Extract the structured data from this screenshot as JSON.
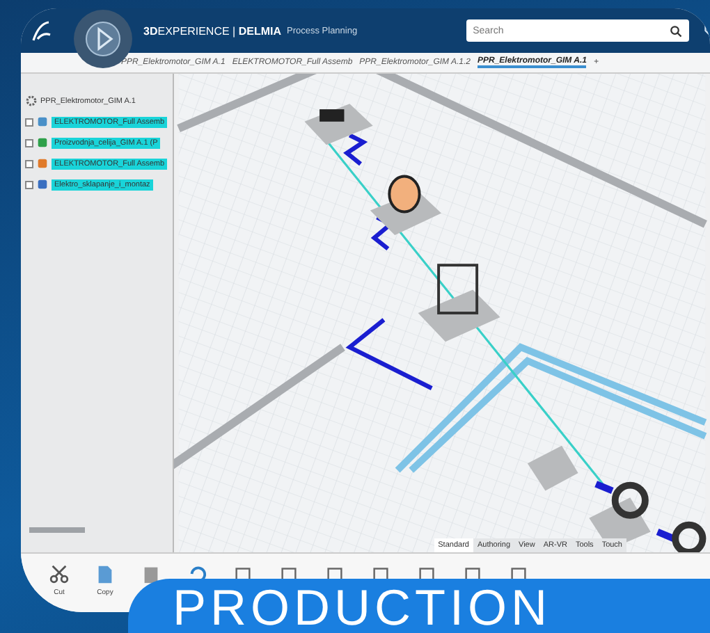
{
  "header": {
    "brand": "**3D**EXPERIENCE | **DELMIA**",
    "app_name": "Process Planning",
    "search": {
      "placeholder": "Search"
    }
  },
  "tabs": [
    {
      "label": "PPR_Elektromotor_GIM A.1",
      "selected": false
    },
    {
      "label": "ELEKTROMOTOR_Full Assemb",
      "selected": false
    },
    {
      "label": "PPR_Elektromotor_GIM A.1.2",
      "selected": false
    },
    {
      "label": "PPR_Elektromotor_GIM A.1",
      "selected": true
    },
    {
      "label": "+",
      "selected": false
    }
  ],
  "tree": {
    "root": "PPR_Elektromotor_GIM A.1",
    "children": [
      {
        "label": "ELEKTROMOTOR_Full Assemb",
        "kind": "product",
        "selected": true
      },
      {
        "label": "Proizvodnja_celija_GIM A.1 (P",
        "kind": "resource",
        "selected": true
      },
      {
        "label": "ELEKTROMOTOR_Full Assemb",
        "kind": "assembly",
        "selected": true
      },
      {
        "label": "Elektro_sklapanje_i_montaz",
        "kind": "process",
        "selected": true
      }
    ]
  },
  "section_tabs": [
    {
      "label": "Standard",
      "selected": true
    },
    {
      "label": "Authoring",
      "selected": false
    },
    {
      "label": "View",
      "selected": false
    },
    {
      "label": "AR-VR",
      "selected": false
    },
    {
      "label": "Tools",
      "selected": false
    },
    {
      "label": "Touch",
      "selected": false
    }
  ],
  "toolbar": [
    {
      "label": "Cut",
      "kind": "cut"
    },
    {
      "label": "Copy",
      "kind": "copy"
    },
    {
      "kind": "paste"
    },
    {
      "kind": "undo"
    },
    {
      "kind": "insert"
    },
    {
      "kind": "edit"
    },
    {
      "kind": "measure"
    },
    {
      "kind": "swap"
    },
    {
      "kind": "frame"
    },
    {
      "kind": "flag"
    },
    {
      "kind": "print"
    }
  ],
  "banner": {
    "text": "PRODUCTION"
  }
}
